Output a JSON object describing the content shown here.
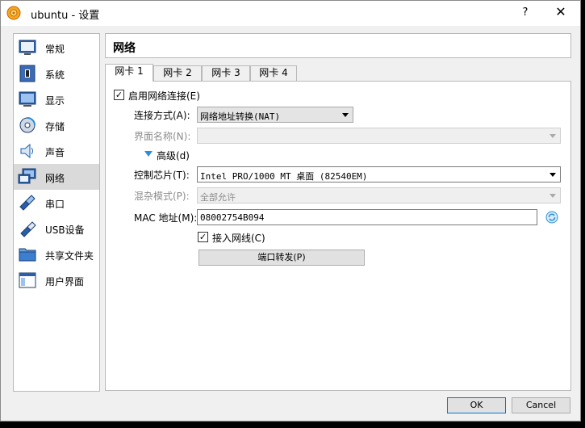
{
  "window": {
    "title": "ubuntu - 设置",
    "help": "?",
    "close": "✕"
  },
  "sidebar": {
    "items": [
      {
        "label": "常规",
        "icon": "general-icon"
      },
      {
        "label": "系统",
        "icon": "system-icon"
      },
      {
        "label": "显示",
        "icon": "display-icon"
      },
      {
        "label": "存储",
        "icon": "storage-icon"
      },
      {
        "label": "声音",
        "icon": "audio-icon"
      },
      {
        "label": "网络",
        "icon": "network-icon",
        "selected": true
      },
      {
        "label": "串口",
        "icon": "serial-port-icon"
      },
      {
        "label": "USB设备",
        "icon": "usb-icon"
      },
      {
        "label": "共享文件夹",
        "icon": "shared-folder-icon"
      },
      {
        "label": "用户界面",
        "icon": "user-interface-icon"
      }
    ]
  },
  "header": {
    "title": "网络"
  },
  "tabs": [
    {
      "label": "网卡 1",
      "active": true
    },
    {
      "label": "网卡 2"
    },
    {
      "label": "网卡 3"
    },
    {
      "label": "网卡 4"
    }
  ],
  "form": {
    "enable_label": "启用网络连接(E)",
    "enable_checked": true,
    "attach_label": "连接方式(A):",
    "attach_value": "网络地址转换(NAT)",
    "name_label": "界面名称(N):",
    "name_value": "",
    "advanced_label": "高级(d)",
    "adapter_label": "控制芯片(T):",
    "adapter_value": "Intel PRO/1000 MT 桌面 (82540EM)",
    "promisc_label": "混杂模式(P):",
    "promisc_value": "全部允许",
    "mac_label": "MAC 地址(M):",
    "mac_value": "08002754B094",
    "cable_label": "接入网线(C)",
    "cable_checked": true,
    "port_forward_label": "端口转发(P)"
  },
  "buttons": {
    "ok": "OK",
    "cancel": "Cancel"
  },
  "colors": {
    "accent": "#0078d7",
    "selected_bg": "#dadada"
  }
}
